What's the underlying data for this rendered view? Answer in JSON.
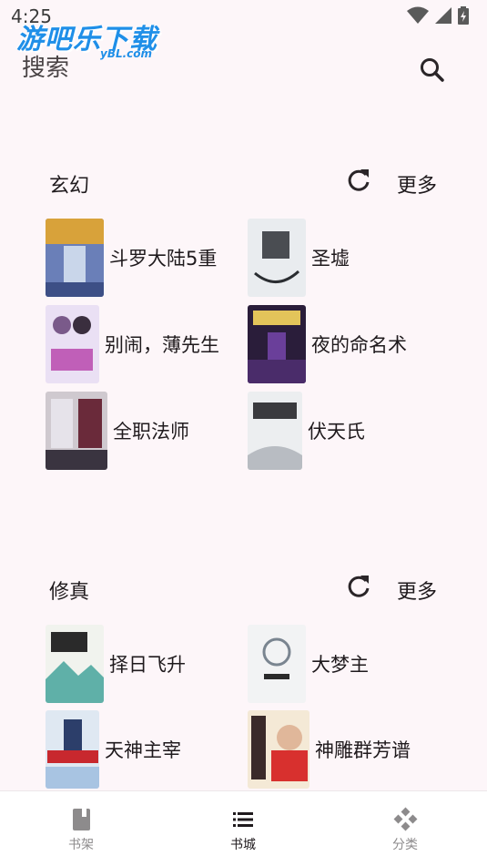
{
  "status_bar": {
    "time": "4:25"
  },
  "watermark": {
    "main": "游吧乐下载",
    "sub": "yBL.com"
  },
  "header": {
    "title": "搜索"
  },
  "sections": [
    {
      "title": "玄幻",
      "more_label": "更多",
      "books": [
        {
          "name": "斗罗大陆5重"
        },
        {
          "name": "圣墟"
        },
        {
          "name": "别闹，薄先生"
        },
        {
          "name": "夜的命名术"
        },
        {
          "name": "全职法师"
        },
        {
          "name": "伏天氏"
        }
      ]
    },
    {
      "title": "修真",
      "more_label": "更多",
      "books": [
        {
          "name": "择日飞升"
        },
        {
          "name": "大梦主"
        },
        {
          "name": "天神主宰"
        },
        {
          "name": "神雕群芳谱"
        }
      ]
    }
  ],
  "bottom_nav": {
    "items": [
      {
        "label": "书架",
        "icon": "bookshelf-icon"
      },
      {
        "label": "书城",
        "icon": "list-icon",
        "active": true
      },
      {
        "label": "分类",
        "icon": "category-icon"
      }
    ]
  },
  "colors": {
    "background": "#fdf6f9",
    "text": "#1f1a1d",
    "watermark": "#1f8fe8"
  }
}
